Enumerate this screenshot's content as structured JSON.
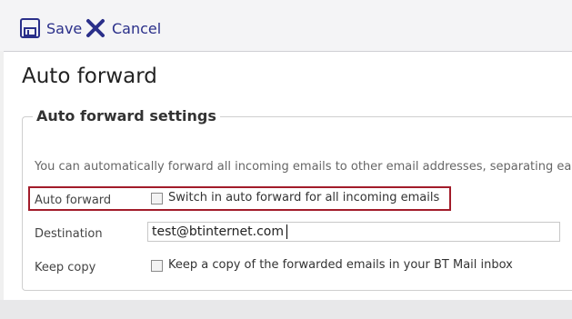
{
  "toolbar": {
    "save_label": "Save",
    "cancel_label": "Cancel",
    "save_icon": "save-disk-icon",
    "cancel_icon": "cancel-x-icon"
  },
  "page": {
    "title": "Auto forward"
  },
  "settings": {
    "legend": "Auto forward settings",
    "description": "You can automatically forward all incoming emails to other email addresses, separating eac",
    "auto_forward": {
      "label": "Auto forward",
      "checkbox_label": "Switch in auto forward for all incoming emails",
      "checked": false
    },
    "destination": {
      "label": "Destination",
      "value": "test@btinternet.com"
    },
    "keep_copy": {
      "label": "Keep copy",
      "checkbox_label": "Keep a copy of the forwarded emails in your BT Mail inbox",
      "checked": false
    }
  },
  "colors": {
    "toolbar_text": "#2a2f8a",
    "highlight_border": "#a21c2a"
  }
}
